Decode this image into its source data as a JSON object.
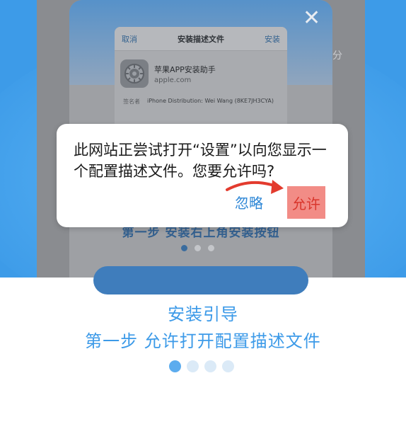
{
  "colors": {
    "accent": "#3c9ae8",
    "highlight": "#f28c86",
    "ios_link": "#2e87d6"
  },
  "background_sheet": {
    "cancel": "取消",
    "title": "安装描述文件",
    "install": "安装",
    "profile_name": "苹果APP安装助手",
    "profile_domain": "apple.com",
    "signed_by_key": "签名者",
    "signed_by_value": "iPhone Distribution: Wei Wang (8KE7JH3CYA)",
    "partial_right": "分"
  },
  "background_step": "第一步  安装右上角安装按钮",
  "alert": {
    "message": "此网站正尝试打开“设置”以向您显示一个配置描述文件。您要允许吗?",
    "ignore": "忽略",
    "allow": "允许"
  },
  "guide": {
    "title": "安装引导",
    "step": "第一步  允许打开配置描述文件"
  },
  "pagination": {
    "total": 4,
    "active": 1
  }
}
